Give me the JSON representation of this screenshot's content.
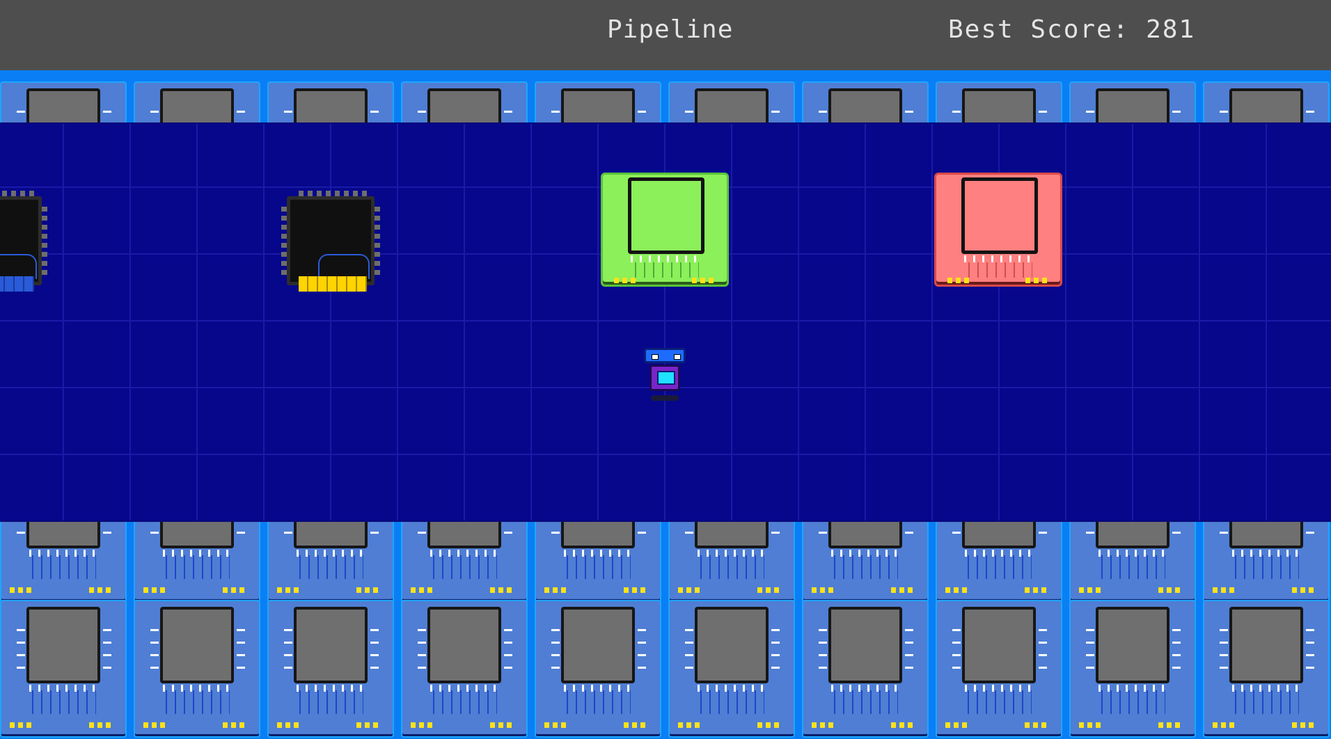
{
  "header": {
    "title": "Pipeline",
    "best_score_label": "Best Score:",
    "best_score_value": "281"
  },
  "colors": {
    "header_bg": "#4e4e4e",
    "board_bg": "#07078c",
    "frame_bg": "#0a7ff5",
    "station_green": "#8cf05a",
    "station_red": "#ff8080"
  },
  "board": {
    "chips": [
      {
        "name": "chip-partial",
        "icon": "cpu-chip-icon"
      },
      {
        "name": "chip",
        "icon": "cpu-chip-icon"
      }
    ],
    "stations": [
      {
        "name": "green-station",
        "color": "#8cf05a",
        "icon": "green-processor-icon"
      },
      {
        "name": "red-station",
        "color": "#ff8080",
        "icon": "red-processor-icon"
      }
    ],
    "player": {
      "icon": "robot-icon"
    }
  }
}
